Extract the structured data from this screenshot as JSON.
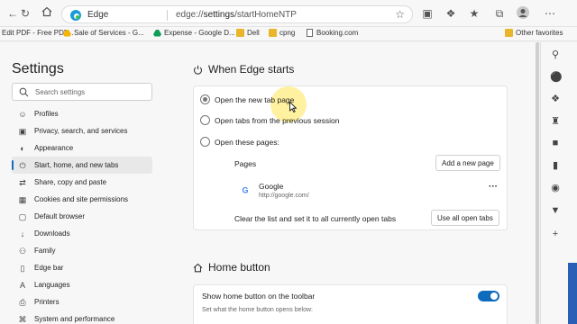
{
  "toolbar": {
    "brand": "Edge",
    "url_prefix": "edge://",
    "url_main": "settings",
    "url_suffix": "/startHomeNTP"
  },
  "favorites": {
    "items": [
      {
        "label": "Edit PDF - Free PDF..."
      },
      {
        "label": "Sale of Services - G..."
      },
      {
        "label": "Expense - Google D..."
      },
      {
        "label": "Dell"
      },
      {
        "label": "cpng"
      },
      {
        "label": "Booking.com"
      }
    ],
    "other": "Other favorites"
  },
  "sidebar": {
    "title": "Settings",
    "search_placeholder": "Search settings",
    "items": [
      {
        "label": "Profiles",
        "icon": "profile-icon"
      },
      {
        "label": "Privacy, search, and services",
        "icon": "lock-icon"
      },
      {
        "label": "Appearance",
        "icon": "appearance-icon"
      },
      {
        "label": "Start, home, and new tabs",
        "icon": "power-icon"
      },
      {
        "label": "Share, copy and paste",
        "icon": "share-icon"
      },
      {
        "label": "Cookies and site permissions",
        "icon": "cookie-icon"
      },
      {
        "label": "Default browser",
        "icon": "browser-icon"
      },
      {
        "label": "Downloads",
        "icon": "download-icon"
      },
      {
        "label": "Family",
        "icon": "family-icon"
      },
      {
        "label": "Edge bar",
        "icon": "edge-bar-icon"
      },
      {
        "label": "Languages",
        "icon": "language-icon"
      },
      {
        "label": "Printers",
        "icon": "printer-icon"
      },
      {
        "label": "System and performance",
        "icon": "system-icon"
      }
    ],
    "active_index": 3
  },
  "startup": {
    "title": "When Edge starts",
    "options": [
      {
        "label": "Open the new tab page",
        "selected": true
      },
      {
        "label": "Open tabs from the previous session",
        "selected": false
      },
      {
        "label": "Open these pages:",
        "selected": false
      }
    ],
    "pages_label": "Pages",
    "add_page": "Add a new page",
    "page": {
      "name": "Google",
      "url": "http://google.com/"
    },
    "more": "···",
    "clear_text": "Clear the list and set it to all currently open tabs",
    "use_all": "Use all open tabs"
  },
  "home": {
    "title": "Home button",
    "toggle_label": "Show home button on the toolbar",
    "toggle_on": true,
    "sub": "Set what the home button opens below:"
  },
  "colors": {
    "accent": "#0f6cbd",
    "cursor_highlight": "#ffe650"
  }
}
